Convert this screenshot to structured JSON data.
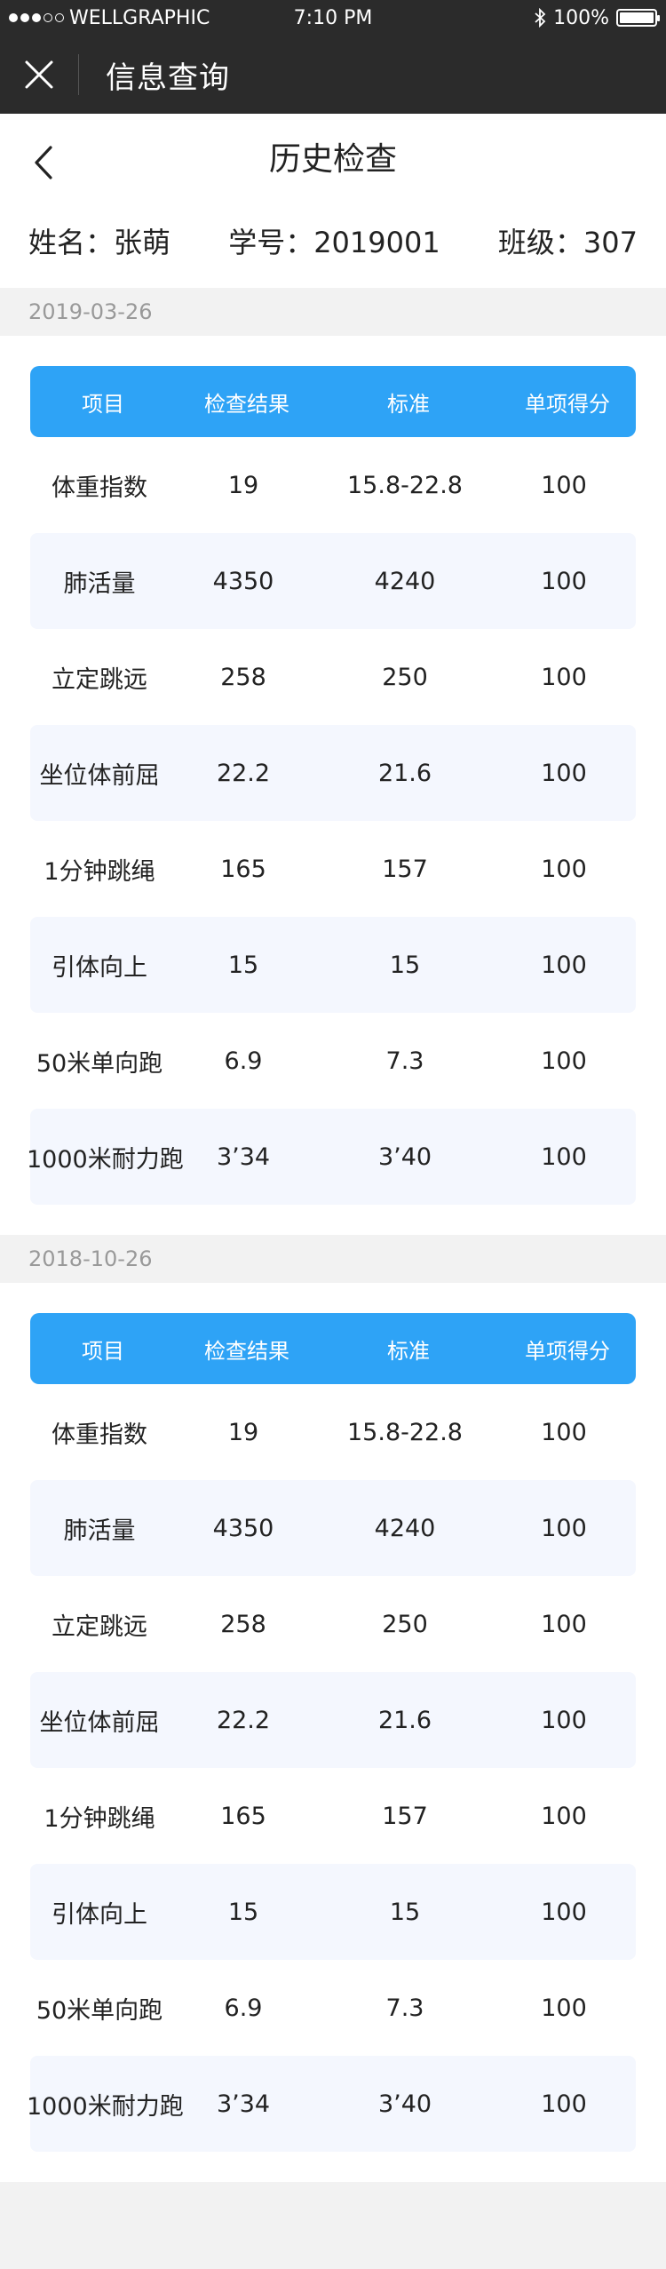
{
  "status_bar": {
    "carrier": "WELLGRAPHIC",
    "time": "7:10 PM",
    "battery": "100%"
  },
  "nav": {
    "title": "信息查询"
  },
  "page": {
    "title": "历史检查"
  },
  "student": {
    "name_label": "姓名：张萌",
    "id_label": "学号：2019001",
    "class_label": "班级：307"
  },
  "columns": [
    "项目",
    "检查结果",
    "标准",
    "单项得分"
  ],
  "records": [
    {
      "date": "2019-03-26",
      "rows": [
        [
          "体重指数",
          "19",
          "15.8-22.8",
          "100"
        ],
        [
          "肺活量",
          "4350",
          "4240",
          "100"
        ],
        [
          "立定跳远",
          "258",
          "250",
          "100"
        ],
        [
          "坐位体前屈",
          "22.2",
          "21.6",
          "100"
        ],
        [
          "1分钟跳绳",
          "165",
          "157",
          "100"
        ],
        [
          "引体向上",
          "15",
          "15",
          "100"
        ],
        [
          "50米单向跑",
          "6.9",
          "7.3",
          "100"
        ],
        [
          "1000米耐力跑",
          "3’34",
          "3’40",
          "100"
        ]
      ]
    },
    {
      "date": "2018-10-26",
      "rows": [
        [
          "体重指数",
          "19",
          "15.8-22.8",
          "100"
        ],
        [
          "肺活量",
          "4350",
          "4240",
          "100"
        ],
        [
          "立定跳远",
          "258",
          "250",
          "100"
        ],
        [
          "坐位体前屈",
          "22.2",
          "21.6",
          "100"
        ],
        [
          "1分钟跳绳",
          "165",
          "157",
          "100"
        ],
        [
          "引体向上",
          "15",
          "15",
          "100"
        ],
        [
          "50米单向跑",
          "6.9",
          "7.3",
          "100"
        ],
        [
          "1000米耐力跑",
          "3’34",
          "3’40",
          "100"
        ]
      ]
    }
  ],
  "colors": {
    "header_dark": "#2b2b2b",
    "table_header": "#2ea3f6",
    "row_alt": "#f4f7fe",
    "background": "#f2f2f2"
  },
  "icons": [
    "signal-dots-icon",
    "bluetooth-icon",
    "battery-icon",
    "close-icon",
    "back-arrow-icon"
  ]
}
